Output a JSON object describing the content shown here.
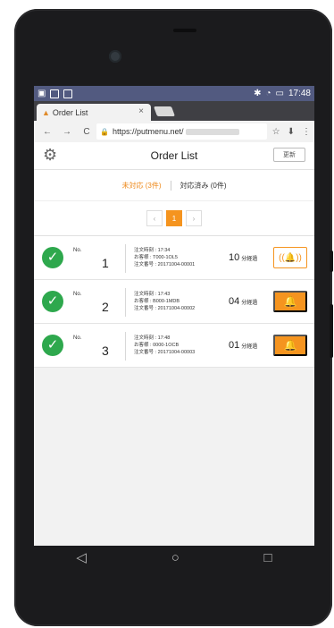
{
  "statusbar": {
    "time": "17:48"
  },
  "browser": {
    "tab_title": "Order List",
    "tab_close": "×",
    "back": "←",
    "forward": "→",
    "reload": "C",
    "url": "https://putmenu.net/",
    "star": "☆",
    "download": "⬇",
    "menu": "⋮"
  },
  "app": {
    "title": "Order List",
    "refresh_label": "更新",
    "filters": {
      "pending": "未対応 (3件)",
      "done": "対応済み (0件)"
    },
    "pager": {
      "prev": "‹",
      "current": "1",
      "next": "›"
    }
  },
  "orders": [
    {
      "no_label": "No.",
      "number": "1",
      "time": "注文時刻 : 17:34",
      "customer": "お客様 : T000-1OL5",
      "order_id": "注文番号 : 20171004-00001",
      "elapsed": "10",
      "unit": "分経過",
      "alert_icon": "((🔔))"
    },
    {
      "no_label": "No.",
      "number": "2",
      "time": "注文時刻 : 17:43",
      "customer": "お客様 : B000-1MDB",
      "order_id": "注文番号 : 20171004-00002",
      "elapsed": "04",
      "unit": "分経過",
      "alert_icon": "🔔"
    },
    {
      "no_label": "No.",
      "number": "3",
      "time": "注文時刻 : 17:48",
      "customer": "お客様 : 0000-1OCB",
      "order_id": "注文番号 : 20171004-00003",
      "elapsed": "01",
      "unit": "分経過",
      "alert_icon": "🔔"
    }
  ],
  "navbar": {
    "back": "◁",
    "home": "○",
    "recents": "□"
  },
  "colors": {
    "accent": "#f5941f",
    "check": "#2ea84d",
    "statusbar": "#525a80"
  }
}
